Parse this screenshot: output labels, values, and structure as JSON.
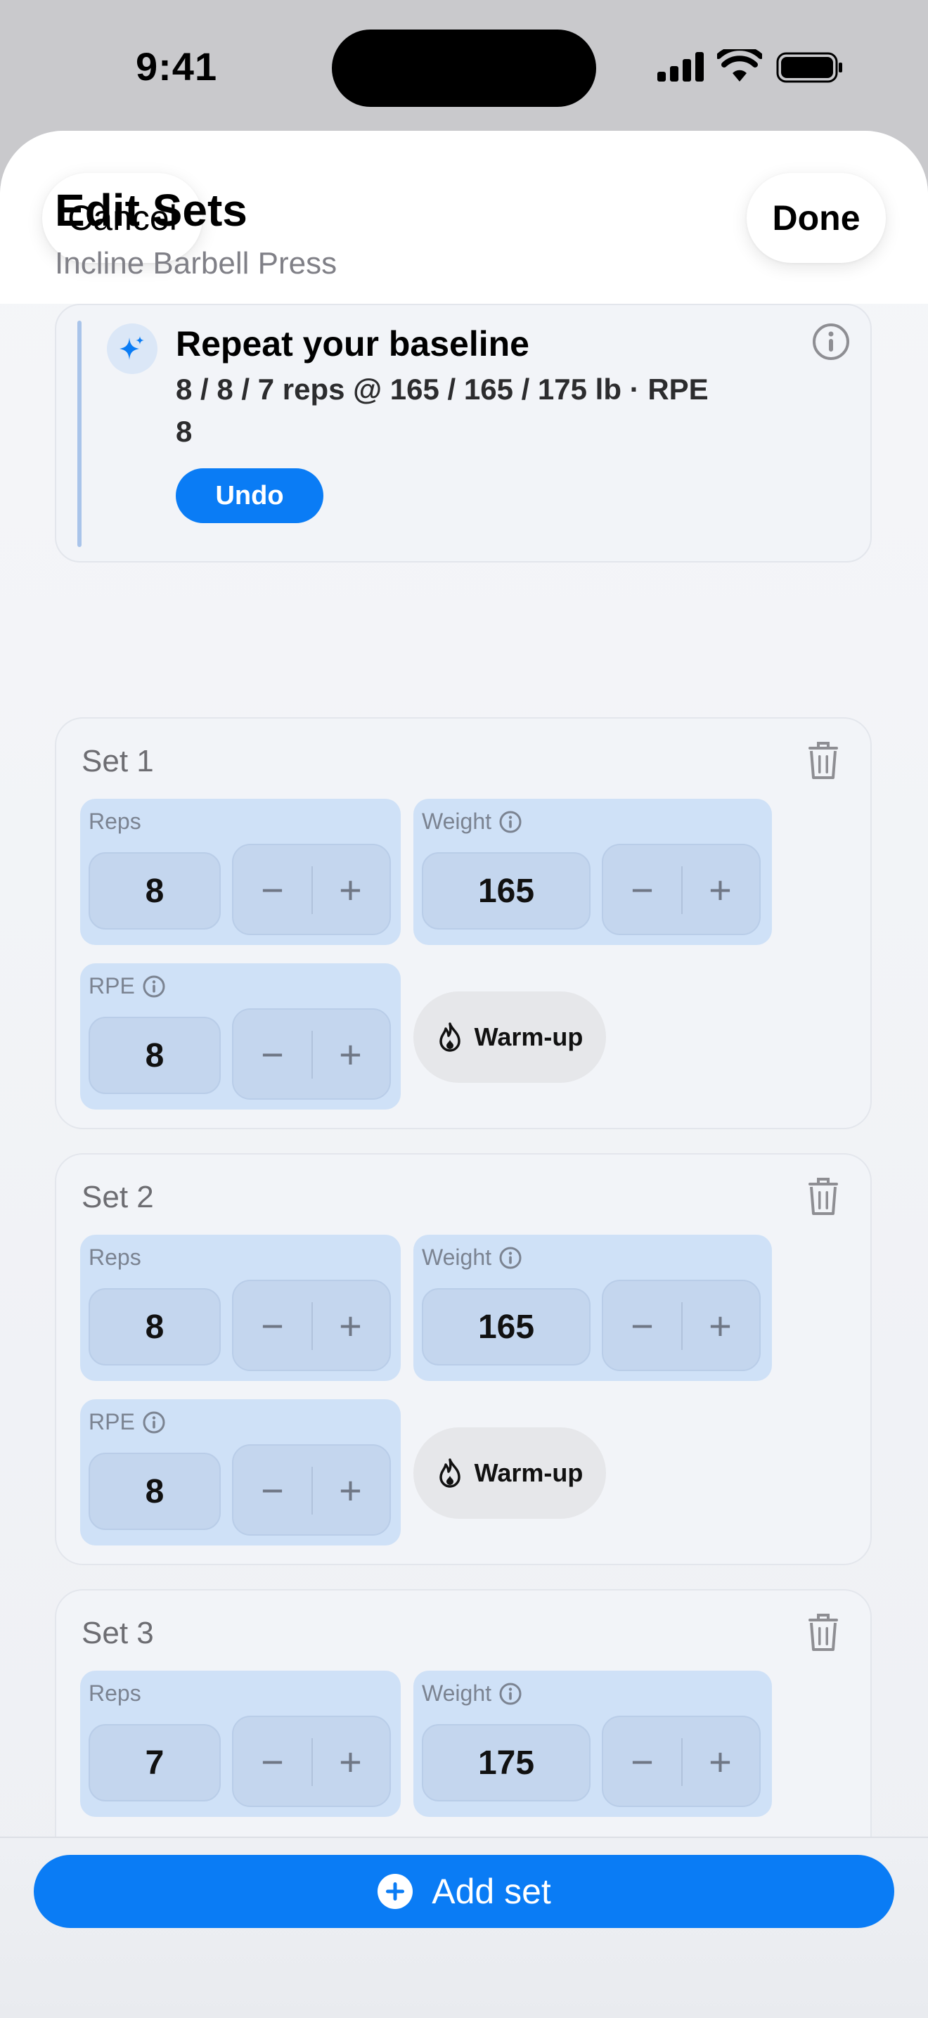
{
  "status_bar": {
    "time": "9:41"
  },
  "nav": {
    "cancel_label": "Cancel",
    "done_label": "Done"
  },
  "page": {
    "title": "Edit Sets",
    "subtitle": "Incline Barbell Press"
  },
  "suggestion": {
    "title": "Repeat your baseline",
    "detail": "8 / 8 / 7 reps @ 165 / 165 / 175 lb · RPE 8",
    "undo_label": "Undo"
  },
  "labels": {
    "reps": "Reps",
    "weight": "Weight",
    "rpe": "RPE",
    "minus": "−",
    "plus": "+",
    "warmup": "Warm-up"
  },
  "sets": [
    {
      "title": "Set 1",
      "reps": "8",
      "weight": "165",
      "rpe": "8"
    },
    {
      "title": "Set 2",
      "reps": "8",
      "weight": "165",
      "rpe": "8"
    },
    {
      "title": "Set 3",
      "reps": "7",
      "weight": "175"
    }
  ],
  "add_set_label": "Add set",
  "colors": {
    "accent": "#0A7CF5",
    "field_bg": "#CFE1F7"
  }
}
